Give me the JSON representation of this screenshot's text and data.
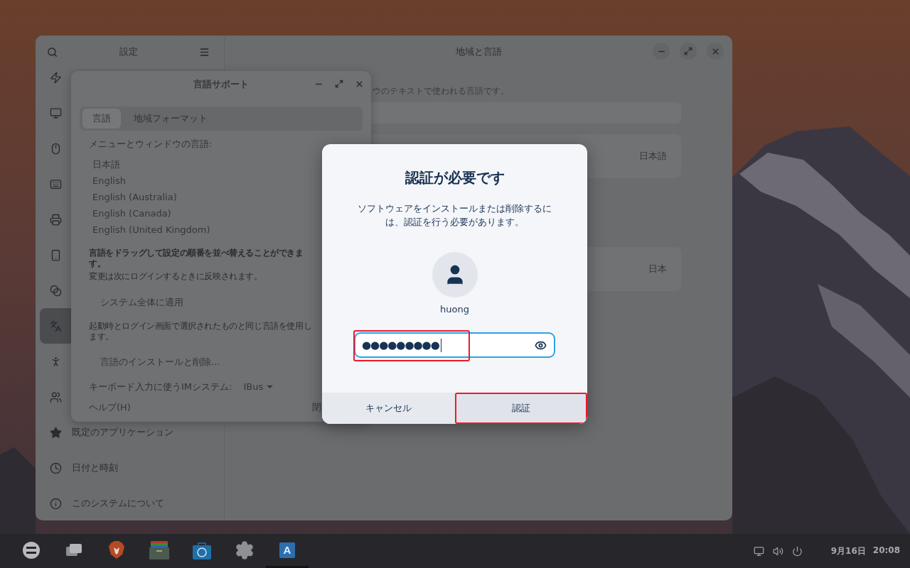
{
  "settings": {
    "title": "設定",
    "panel_title": "地域と言語",
    "sidebar": [
      {
        "selected": false
      },
      {
        "selected": false
      },
      {
        "selected": false
      },
      {
        "selected": false
      },
      {
        "selected": false
      },
      {
        "selected": false
      },
      {
        "selected": false
      },
      {
        "selected": true
      },
      {
        "selected": false
      },
      {
        "selected": false
      },
      {
        "selected": false,
        "label": "既定のアプリケーション"
      },
      {
        "selected": false,
        "label": "日付と時刻"
      },
      {
        "selected": false,
        "label": "このシステムについて"
      }
    ],
    "description": "ウのテキストで使われる言語です。",
    "rows": [
      {
        "value": "日本語"
      },
      {
        "value": "日本"
      }
    ]
  },
  "language_support": {
    "title": "言語サポート",
    "tabs": [
      {
        "label": "言語",
        "selected": true
      },
      {
        "label": "地域フォーマット",
        "selected": false
      }
    ],
    "list_label": "メニューとウィンドウの言語:",
    "languages": [
      "日本語",
      "English",
      "English (Australia)",
      "English (Canada)",
      "English (United Kingdom)"
    ],
    "hint": "言語をドラッグして設定の順番を並べ替えることができます。",
    "hint_note": "変更は次にログインするときに反映されます。",
    "apply_button": "システム全体に適用",
    "apply_note": "起動時とログイン画面で選択されたものと同じ言語を使用します。",
    "install_button": "言語のインストールと削除...",
    "im_label": "キーボード入力に使うIMシステム:",
    "im_value": "IBus",
    "help_button": "ヘルプ(H)",
    "close_button": "閉"
  },
  "auth": {
    "title": "認証が必要です",
    "message": "ソフトウェアをインストールまたは削除するには、認証を行う必要があります。",
    "username": "huong",
    "password": "●●●●●●●●●",
    "password_highlighted": true,
    "buttons": [
      {
        "label": "キャンセル",
        "highlighted": false
      },
      {
        "label": "認証",
        "highlighted": true
      }
    ]
  },
  "taskbar": {
    "apps": [
      {
        "kind": "logo",
        "active": false
      },
      {
        "kind": "windows",
        "active": false
      },
      {
        "kind": "browser",
        "active": false
      },
      {
        "kind": "files",
        "active": false
      },
      {
        "kind": "store",
        "active": false
      },
      {
        "kind": "settings",
        "active": false
      },
      {
        "kind": "language",
        "glyph": "A",
        "active": true
      }
    ],
    "date": "9月16日",
    "time": "20:08"
  }
}
